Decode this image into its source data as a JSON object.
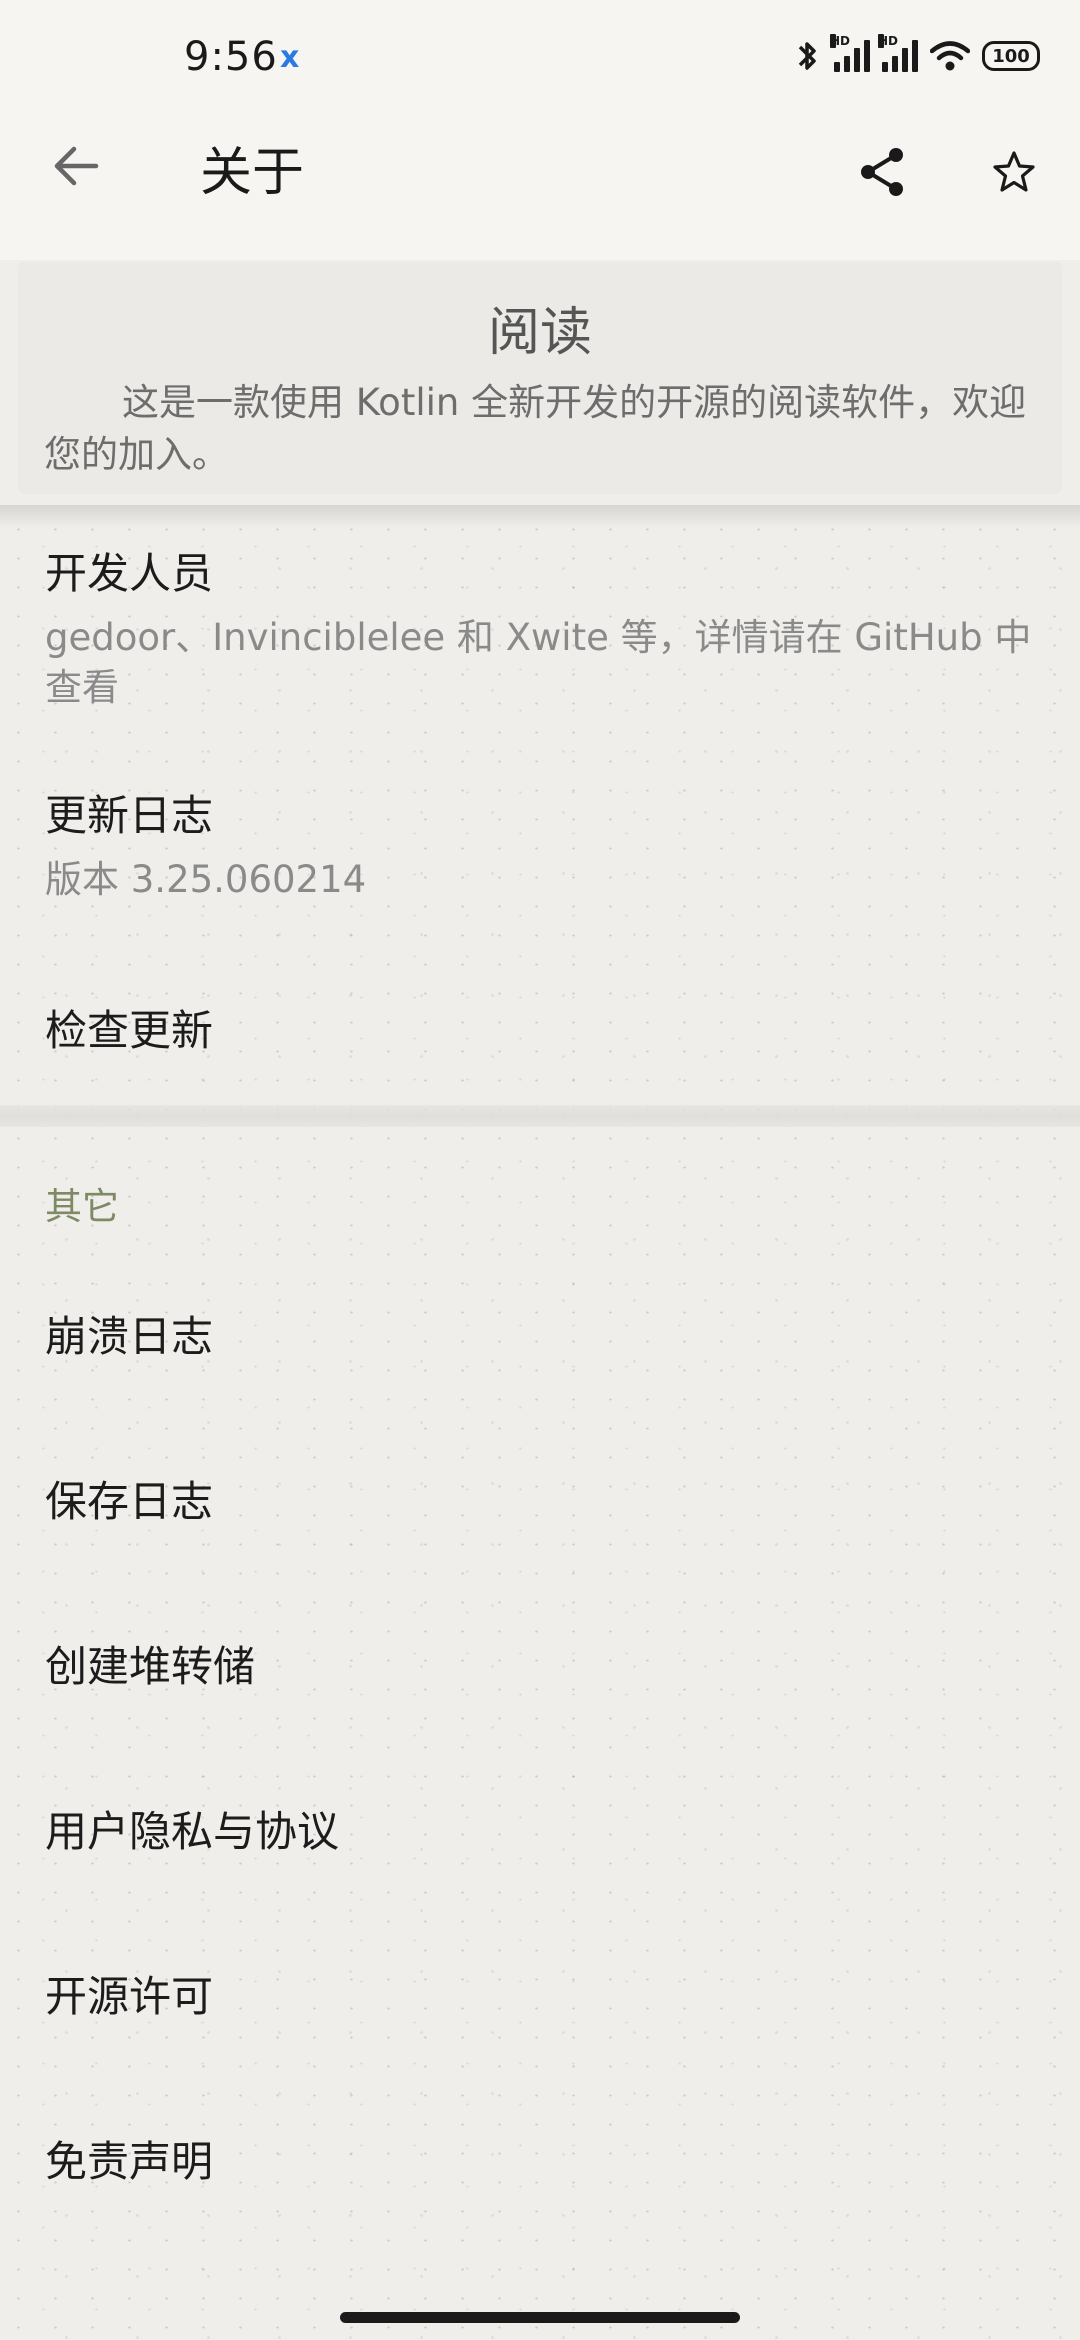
{
  "status_bar": {
    "time": "9:56",
    "notification_badge": "x",
    "battery_level": "100",
    "icons": [
      "bluetooth-icon",
      "hd-signal-icon",
      "hd-signal-icon",
      "wifi-icon",
      "battery-icon"
    ]
  },
  "app_bar": {
    "title": "关于",
    "back_icon": "arrow-left-icon",
    "share_icon": "share-icon",
    "star_icon": "star-outline-icon"
  },
  "header_card": {
    "app_name": "阅读",
    "description": "这是一款使用 Kotlin 全新开发的开源的阅读软件，欢迎您的加入。"
  },
  "items": {
    "developers": {
      "title": "开发人员",
      "subtitle": "gedoor、Invinciblelee 和 Xwite 等，详情请在 GitHub 中查看"
    },
    "changelog": {
      "title": "更新日志",
      "subtitle": "版本 3.25.060214"
    },
    "check_update": {
      "title": "检查更新"
    }
  },
  "other_section": {
    "header": "其它",
    "items": [
      {
        "title": "崩溃日志"
      },
      {
        "title": "保存日志"
      },
      {
        "title": "创建堆转储"
      },
      {
        "title": "用户隐私与协议"
      },
      {
        "title": "开源许可"
      },
      {
        "title": "免责声明"
      }
    ]
  },
  "colors": {
    "accent": "#7e8a64",
    "background": "#efeeeb",
    "status_badge": "#2a7ae4"
  }
}
